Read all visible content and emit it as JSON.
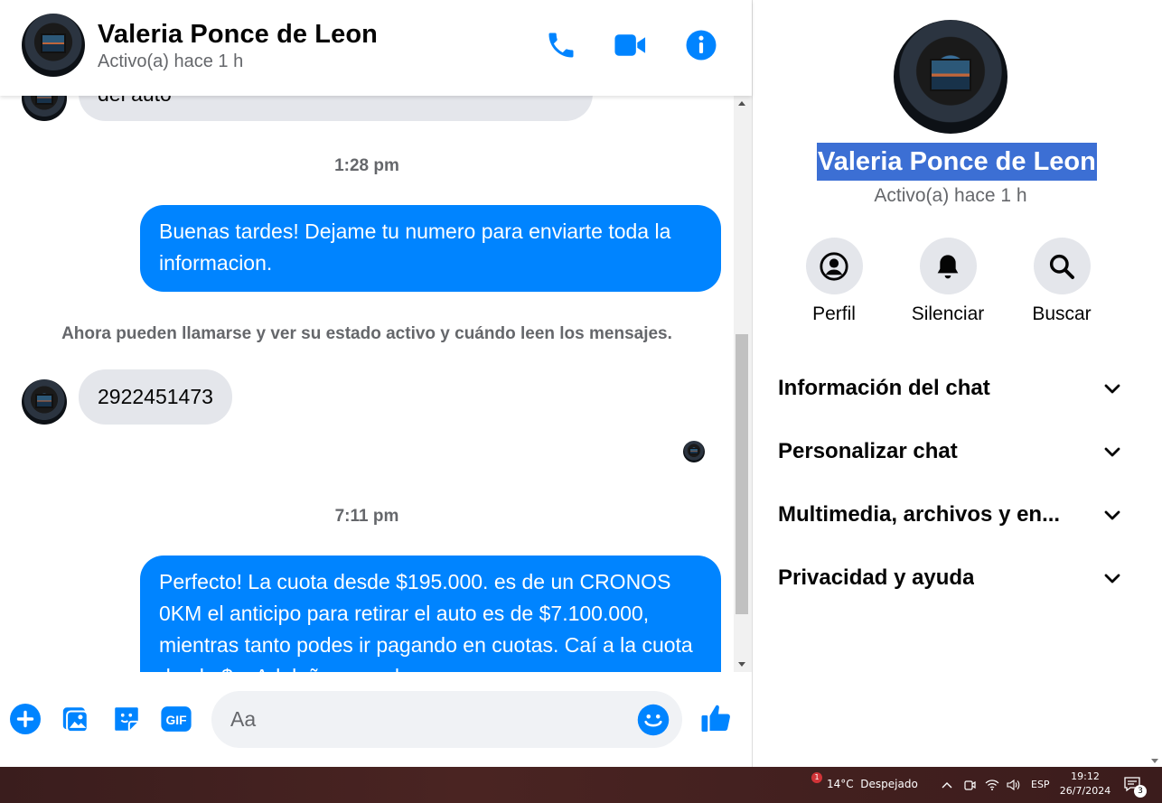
{
  "header": {
    "name": "Valeria Ponce de Leon",
    "status": "Activo(a) hace 1 h",
    "icons": [
      "phone-icon",
      "video-icon",
      "info-icon"
    ]
  },
  "messages": {
    "partial_text": "del auto",
    "time1": "1:28 pm",
    "out1": "Buenas tardes! Dejame tu numero para enviarte toda la informacion.",
    "system": "Ahora pueden llamarse y ver su estado activo y cuándo leen los mensajes.",
    "in1": "2922451473",
    "time2": "7:11 pm",
    "out2": "Perfecto! La cuota desde $195.000. es de un CRONOS 0KM el anticipo para retirar el auto es de $7.100.000, mientras tanto podes ir pagando en cuotas. Caí a la cuota desde $... Adelaño, cuando"
  },
  "composer": {
    "placeholder": "Aa",
    "icons": [
      "plus-icon",
      "image-icon",
      "sticker-icon",
      "gif-icon",
      "emoji-icon",
      "like-icon"
    ]
  },
  "info": {
    "name": "Valeria Ponce de Leon",
    "status": "Activo(a) hace 1 h",
    "actions": [
      {
        "label": "Perfil",
        "icon": "profile-icon"
      },
      {
        "label": "Silenciar",
        "icon": "bell-icon"
      },
      {
        "label": "Buscar",
        "icon": "search-icon"
      }
    ],
    "sections": [
      "Información del chat",
      "Personalizar chat",
      "Multimedia, archivos y en...",
      "Privacidad y ayuda"
    ]
  },
  "taskbar": {
    "weather_badge": "1",
    "weather": "14°C  Despejado",
    "lang": "ESP",
    "time": "19:12",
    "date": "26/7/2024",
    "notifications": "3"
  },
  "colors": {
    "accent": "#0084ff",
    "incoming_bubble": "#e4e6eb",
    "selection": "#3c6fd4"
  }
}
